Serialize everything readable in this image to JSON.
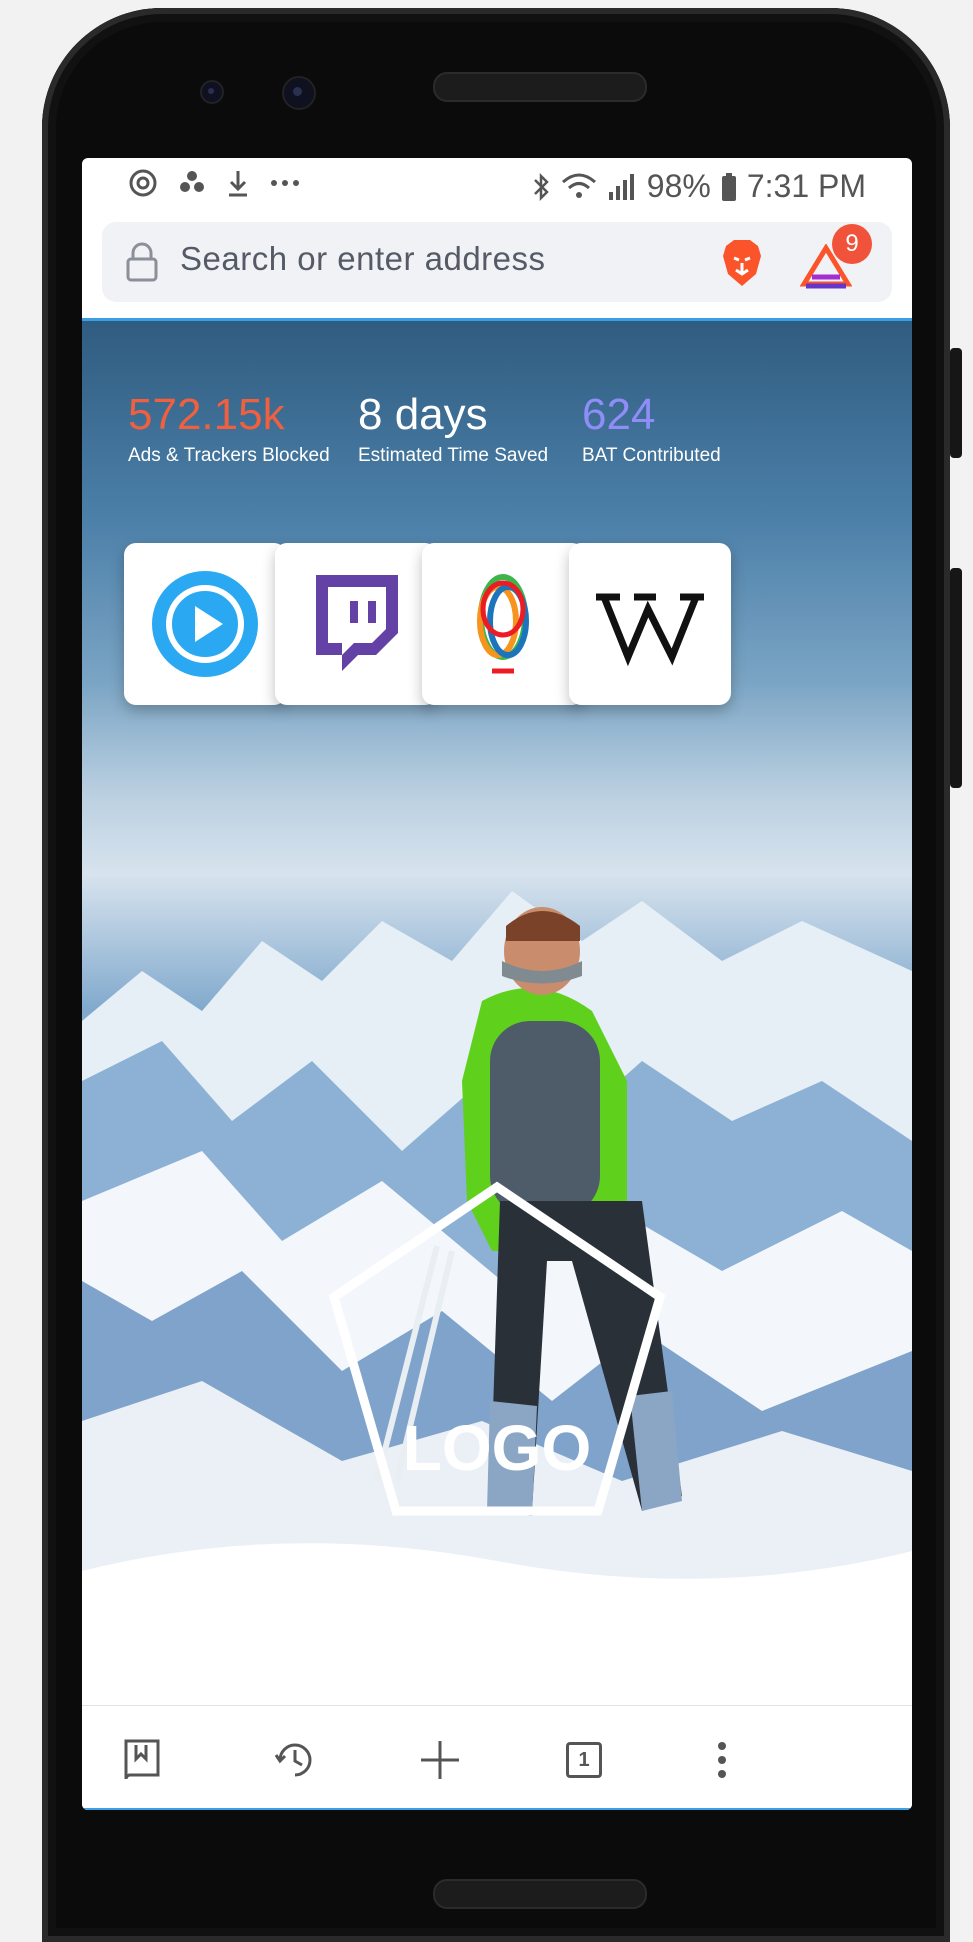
{
  "status_bar": {
    "battery": "98%",
    "time": "7:31 PM"
  },
  "address_bar": {
    "placeholder": "Search or enter address",
    "rewards_badge_count": "9"
  },
  "stats": [
    {
      "value": "572.15k",
      "label": "Ads & Trackers Blocked",
      "color": "#f0603f"
    },
    {
      "value": "8 days",
      "label": "Estimated Time Saved",
      "color": "#ffffff"
    },
    {
      "value": "624",
      "label": "BAT Contributed",
      "color": "#8f8df7"
    }
  ],
  "top_sites": [
    {
      "icon": "play-circle-icon"
    },
    {
      "icon": "twitch-icon"
    },
    {
      "icon": "colorful-loop-icon"
    },
    {
      "icon": "wikipedia-icon"
    }
  ],
  "logo": {
    "text": "LOGO"
  },
  "toolbar": {
    "tabs_count": "1",
    "icons": [
      "bookmarks-icon",
      "history-icon",
      "new-tab-icon",
      "tabs-icon",
      "menu-icon"
    ]
  },
  "colors": {
    "accent": "#3aa0e6",
    "badge": "#f0523a",
    "brave_orange": "#fb542b"
  }
}
